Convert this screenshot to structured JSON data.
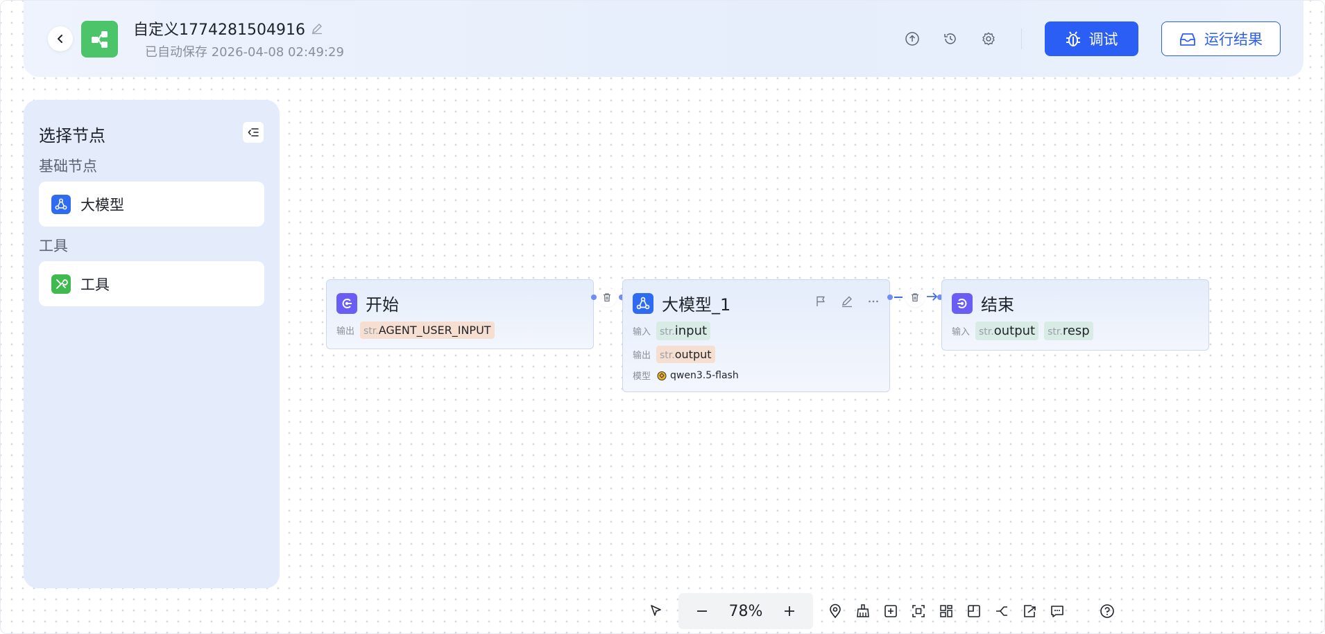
{
  "header": {
    "title": "自定义1774281504916",
    "autosave": "已自动保存 2026-04-08 02:49:29",
    "debug_label": "调试",
    "result_label": "运行结果",
    "accent": "#2b5ef5"
  },
  "sidebar": {
    "title": "选择节点",
    "section_basic": "基础节点",
    "item_llm": "大模型",
    "section_tools": "工具",
    "item_tool": "工具"
  },
  "nodes": {
    "start": {
      "title": "开始",
      "output_label": "输出",
      "output_prefix": "str.",
      "output_value": "AGENT_USER_INPUT"
    },
    "llm": {
      "title": "大模型_1",
      "input_label": "输入",
      "input_prefix": "str.",
      "input_value": "input",
      "output_label": "输出",
      "output_prefix": "str.",
      "output_value": "output",
      "model_label": "模型",
      "model_value": "qwen3.5-flash"
    },
    "end": {
      "title": "结束",
      "input_label": "输入",
      "input1_prefix": "str.",
      "input1_value": "output",
      "input2_prefix": "str.",
      "input2_value": "resp"
    }
  },
  "toolbar": {
    "zoom": "78%"
  }
}
